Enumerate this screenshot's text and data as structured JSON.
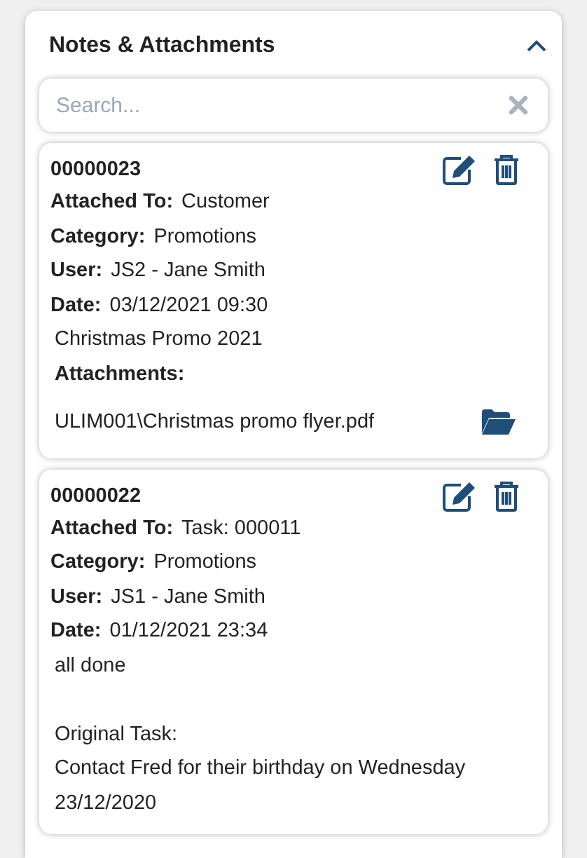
{
  "panel": {
    "title": "Notes & Attachments",
    "expanded": true
  },
  "search": {
    "placeholder": "Search..."
  },
  "notes": [
    {
      "number": "00000023",
      "fields": [
        {
          "label": "Attached To:",
          "value": "Customer"
        },
        {
          "label": "Category:",
          "value": "Promotions"
        },
        {
          "label": "User:",
          "value": "JS2 - Jane Smith"
        },
        {
          "label": "Date:",
          "value": "03/12/2021 09:30"
        }
      ],
      "text": "Christmas Promo 2021",
      "attachments_label": "Attachments:",
      "attachments": [
        "ULIM001\\Christmas promo flyer.pdf"
      ]
    },
    {
      "number": "00000022",
      "fields": [
        {
          "label": "Attached To:",
          "value": "Task: 000011"
        },
        {
          "label": "Category:",
          "value": "Promotions"
        },
        {
          "label": "User:",
          "value": "JS1 - Jane Smith"
        },
        {
          "label": "Date:",
          "value": "01/12/2021 23:34"
        }
      ],
      "text": "all done\n\nOriginal Task:\nContact Fred for their birthday on Wednesday 23/12/2020"
    }
  ]
}
